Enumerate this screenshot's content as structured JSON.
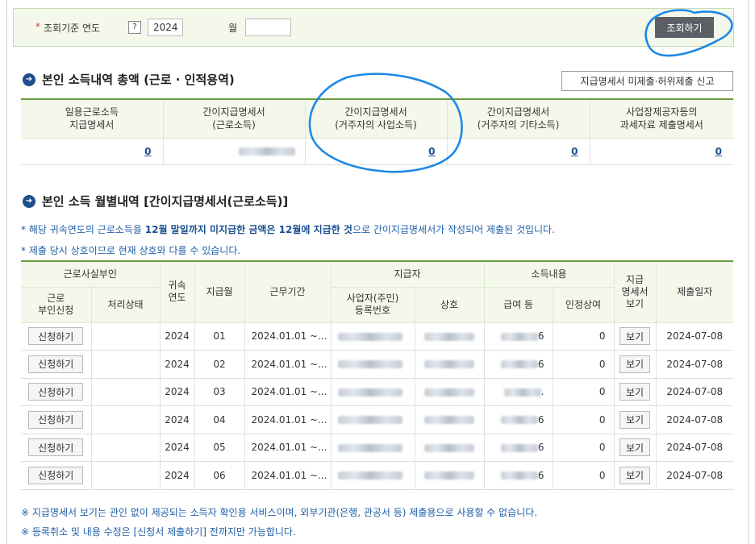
{
  "search": {
    "required_mark": "*",
    "year_label": "조회기준 연도",
    "help": "?",
    "year_value": "2024",
    "month_label": "월",
    "month_value": "",
    "query_button": "조회하기"
  },
  "summary": {
    "title": "본인 소득내역 총액 (근로 · 인적용역)",
    "report_button": "지급명세서 미제출·허위제출 신고",
    "headers": [
      [
        "일용근로소득",
        "지급명세서"
      ],
      [
        "간이지급명세서",
        "(근로소득)"
      ],
      [
        "간이지급명세서",
        "(거주자의 사업소득)"
      ],
      [
        "간이지급명세서",
        "(거주자의 기타소득)"
      ],
      [
        "사업장제공자등의",
        "과세자료 제출명세서"
      ]
    ],
    "values": [
      "0",
      "",
      "0",
      "0",
      "0"
    ]
  },
  "monthly": {
    "title": "본인 소득 월별내역 [간이지급명세서(근로소득)]",
    "note1_a": "* 해당 귀속연도의 근로소득을 ",
    "note1_b": "12월 말일까지 미지급한 금액은 12월에 지급한 것",
    "note1_c": "으로 간이지급명세서가 작성되어 제출된 것입니다.",
    "note2": "* 제출 당시 상호이므로 현재 상호와 다를 수 있습니다.",
    "headers": {
      "group_work": "근로사실부인",
      "year": [
        "귀속",
        "연도"
      ],
      "month": "지급월",
      "period": "근무기간",
      "group_payer": "지급자",
      "group_income": "소득내용",
      "view": [
        "지급",
        "명세서",
        "보기"
      ],
      "submit_date": "제출일자",
      "apply": [
        "근로",
        "부인신청"
      ],
      "status": "처리상태",
      "biz_no": [
        "사업자(주민)",
        "등록번호"
      ],
      "company": "상호",
      "salary": "급여 등",
      "bonus": "인정상여"
    },
    "apply_label": "신청하기",
    "view_label": "보기",
    "rows": [
      {
        "year": "2024",
        "month": "01",
        "period": "2024.01.01 ~...",
        "salary_tail": "6",
        "bonus": "0",
        "date": "2024-07-08"
      },
      {
        "year": "2024",
        "month": "02",
        "period": "2024.01.01 ~...",
        "salary_tail": "6",
        "bonus": "0",
        "date": "2024-07-08"
      },
      {
        "year": "2024",
        "month": "03",
        "period": "2024.01.01 ~...",
        "salary_tail": ".",
        "bonus": "0",
        "date": "2024-07-08"
      },
      {
        "year": "2024",
        "month": "04",
        "period": "2024.01.01 ~...",
        "salary_tail": "6",
        "bonus": "0",
        "date": "2024-07-08"
      },
      {
        "year": "2024",
        "month": "05",
        "period": "2024.01.01 ~...",
        "salary_tail": "6",
        "bonus": "0",
        "date": "2024-07-08"
      },
      {
        "year": "2024",
        "month": "06",
        "period": "2024.01.01 ~...",
        "salary_tail": "6",
        "bonus": "0",
        "date": "2024-07-08"
      }
    ]
  },
  "footnotes": [
    "※ 지급명세서 보기는 관인 없이 제공되는 소득자 확인용 서비스이며, 외부기관(은행, 관공서 등) 제출용으로 사용할 수 없습니다.",
    "※ 등록취소 및 내용 수정은 [신청서 제출하기] 전까지만 가능합니다."
  ],
  "colors": {
    "accent_green": "#6a9a3a",
    "header_bg": "#f3f8ea",
    "link_blue": "#1f4e8c",
    "annotation_blue": "#1e88e5"
  }
}
